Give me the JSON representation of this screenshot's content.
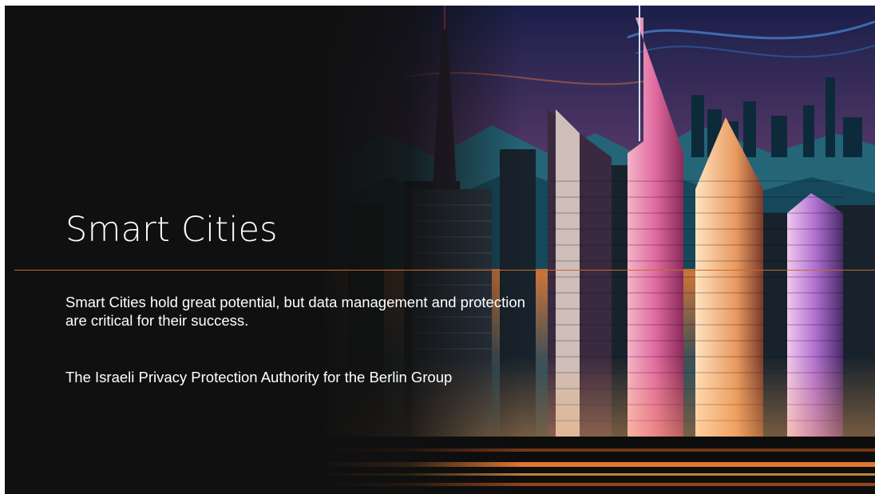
{
  "slide": {
    "title": "Smart Cities",
    "subtitle": "Smart Cities hold great potential, but data management and protection are critical for their success.",
    "author": "The Israeli Privacy Protection Authority for the Berlin Group",
    "image": "illustrated neon city skyline with skyscrapers at dusk",
    "colors": {
      "background": "#101010",
      "text": "#ffffff",
      "accent_rule": "#c86a2a"
    }
  }
}
